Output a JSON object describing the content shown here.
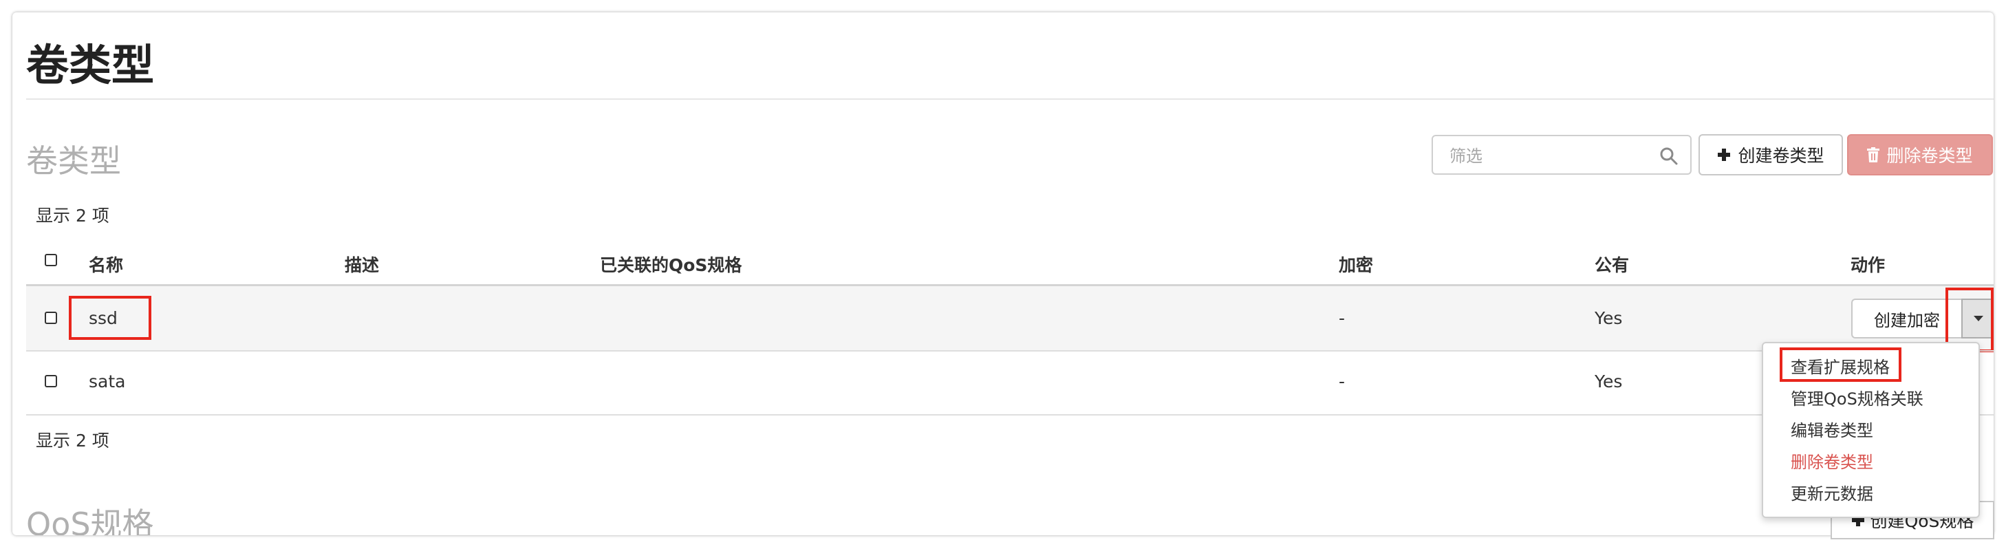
{
  "page": {
    "title": "卷类型"
  },
  "volume_types": {
    "section_title": "卷类型",
    "filter_placeholder": "筛选",
    "create_button": "创建卷类型",
    "delete_button": "删除卷类型",
    "count_top": "显示 2 项",
    "count_bottom": "显示 2 项",
    "columns": [
      "名称",
      "描述",
      "已关联的QoS规格",
      "加密",
      "公有",
      "动作"
    ],
    "rows": [
      {
        "name": "ssd",
        "description": "",
        "qos": "",
        "encryption": "-",
        "public": "Yes",
        "action": "创建加密"
      },
      {
        "name": "sata",
        "description": "",
        "qos": "",
        "encryption": "-",
        "public": "Yes",
        "action": ""
      }
    ]
  },
  "dropdown": {
    "items": [
      {
        "label": "查看扩展规格",
        "danger": false
      },
      {
        "label": "管理QoS规格关联",
        "danger": false
      },
      {
        "label": "编辑卷类型",
        "danger": false
      },
      {
        "label": "删除卷类型",
        "danger": true
      },
      {
        "label": "更新元数据",
        "danger": false
      }
    ]
  },
  "qos": {
    "section_title": "QoS规格",
    "create_button": "创建QoS规格"
  },
  "colors": {
    "danger_button": "#e79c98",
    "highlight": "#e8261c",
    "danger_text": "#d9534f",
    "section_title": "#b0b0b0"
  }
}
